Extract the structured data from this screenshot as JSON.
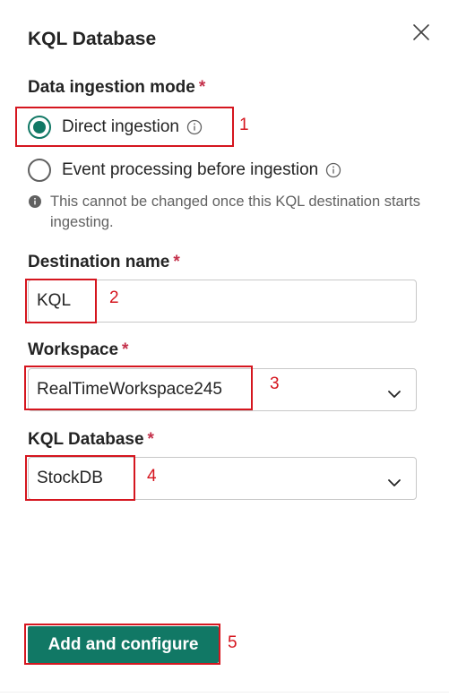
{
  "panel": {
    "title": "KQL Database"
  },
  "ingestion": {
    "label": "Data ingestion mode",
    "required_mark": "*",
    "options": [
      {
        "label": "Direct ingestion",
        "selected": true
      },
      {
        "label": "Event processing before ingestion",
        "selected": false
      }
    ],
    "note": "This cannot be changed once this KQL destination starts ingesting."
  },
  "destination": {
    "label": "Destination name",
    "required_mark": "*",
    "value": "KQL"
  },
  "workspace": {
    "label": "Workspace",
    "required_mark": "*",
    "value": "RealTimeWorkspace245"
  },
  "kql_database": {
    "label": "KQL Database",
    "required_mark": "*",
    "value": "StockDB"
  },
  "actions": {
    "primary_label": "Add and configure"
  },
  "annotations": [
    "1",
    "2",
    "3",
    "4",
    "5"
  ],
  "icons": {
    "close": "close-icon",
    "info": "info-icon",
    "note": "info-filled-icon",
    "chevron": "chevron-down-icon"
  },
  "colors": {
    "accent": "#117865",
    "required": "#c4314b",
    "annotation": "#d5161f"
  }
}
